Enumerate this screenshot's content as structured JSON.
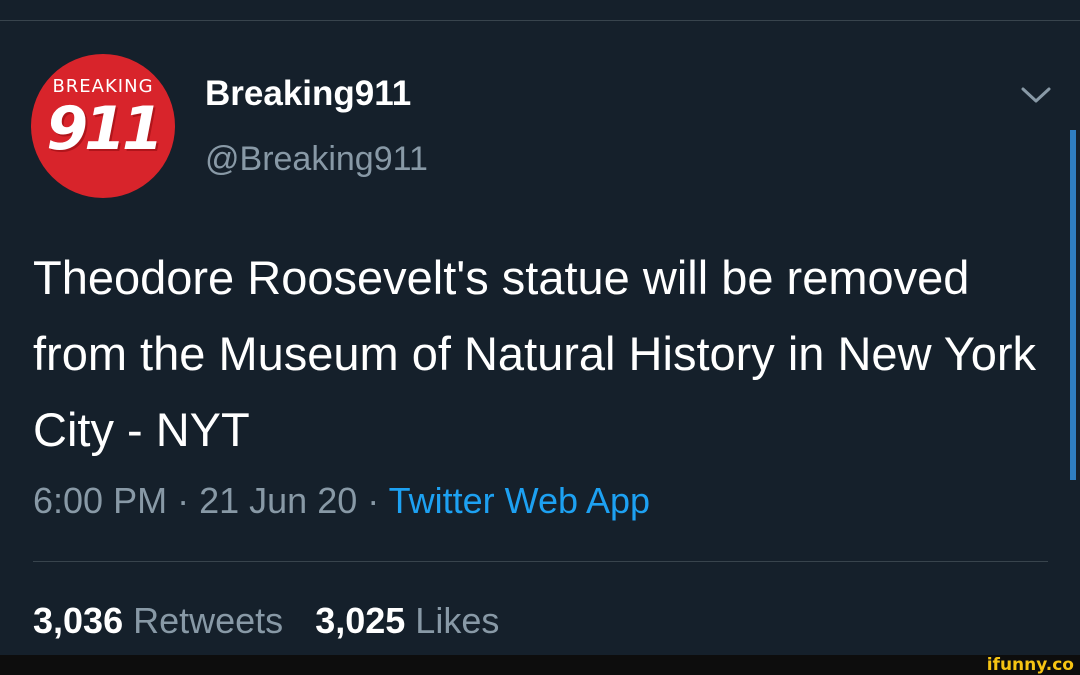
{
  "tweet": {
    "avatar_text_top": "BREAKING",
    "avatar_text_number": "911",
    "display_name": "Breaking911",
    "handle": "@Breaking911",
    "text": "Theodore Roosevelt's statue will be removed from the Museum of Natural History in New York City - NYT",
    "time": "6:00 PM",
    "date": "21 Jun 20",
    "separator": "·",
    "source": "Twitter Web App",
    "retweets_count": "3,036",
    "retweets_label": "Retweets",
    "likes_count": "3,025",
    "likes_label": "Likes"
  },
  "icons": {
    "menu": "chevron-down-icon"
  },
  "colors": {
    "background": "#15202b",
    "secondary_text": "#8899a6",
    "link": "#1da1f2",
    "avatar": "#d8242b"
  },
  "watermark": "ifunny.co"
}
